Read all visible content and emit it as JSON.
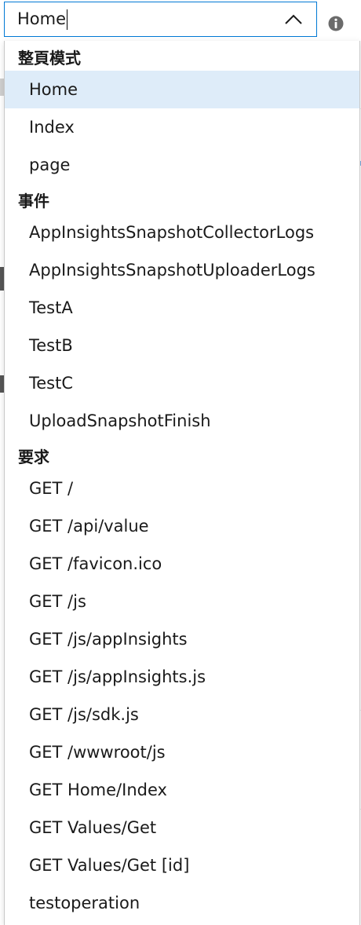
{
  "combo": {
    "value": "Home",
    "chevron_icon": "chevron-up-icon",
    "info_icon": "info-icon"
  },
  "dropdown": {
    "groups": [
      {
        "header": "整頁模式",
        "items": [
          "Home",
          "Index",
          "page"
        ]
      },
      {
        "header": "事件",
        "items": [
          "AppInsightsSnapshotCollectorLogs",
          "AppInsightsSnapshotUploaderLogs",
          "TestA",
          "TestB",
          "TestC",
          "UploadSnapshotFinish"
        ]
      },
      {
        "header": "要求",
        "items": [
          "GET /",
          "GET /api/value",
          "GET /favicon.ico",
          "GET /js",
          "GET /js/appInsights",
          "GET /js/appInsights.js",
          "GET /js/sdk.js",
          "GET /wwwroot/js",
          "GET Home/Index",
          "GET Values/Get",
          "GET Values/Get [id]",
          "testoperation"
        ]
      }
    ]
  },
  "colors": {
    "accent_border": "#0078d4",
    "selected_bg": "#deecf9",
    "info_icon": "#6b6b6b"
  }
}
